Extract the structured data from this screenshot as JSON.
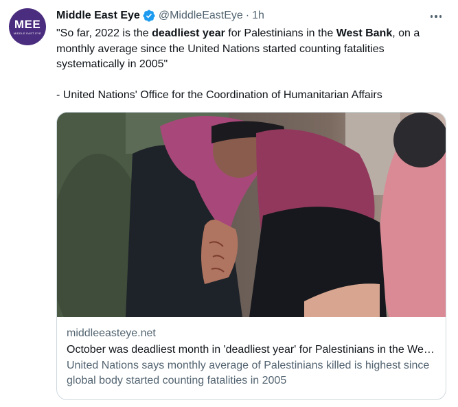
{
  "author": {
    "avatar_text": "MEE",
    "avatar_subtext": "Middle East Eye",
    "display_name": "Middle East Eye",
    "handle": "@MiddleEastEye",
    "separator": "·",
    "time": "1h",
    "verified": true
  },
  "tweet": {
    "line1_a": "\"So far, 2022 is the ",
    "line1_bold1": "deadliest year",
    "line1_b": " for Palestinians in the ",
    "line1_bold2": "West Bank",
    "line1_c": ", on a monthly average since the United Nations started counting fatalities systematically in 2005\"",
    "attribution": "- United Nations' Office for the Coordination of Humanitarian Affairs"
  },
  "card": {
    "domain": "middleeasteye.net",
    "title": "October was deadliest month in 'deadliest year' for Palestinians in the West Bank",
    "description": "United Nations says monthly average of Palestinians killed is highest since global body started counting fatalities in 2005"
  },
  "colors": {
    "avatar_bg": "#4b2d7f",
    "verified": "#1d9bf0",
    "secondary_text": "#536471",
    "border": "#cfd9de"
  },
  "icons": {
    "verified": "verified-badge-icon",
    "more": "more-dots-icon"
  }
}
